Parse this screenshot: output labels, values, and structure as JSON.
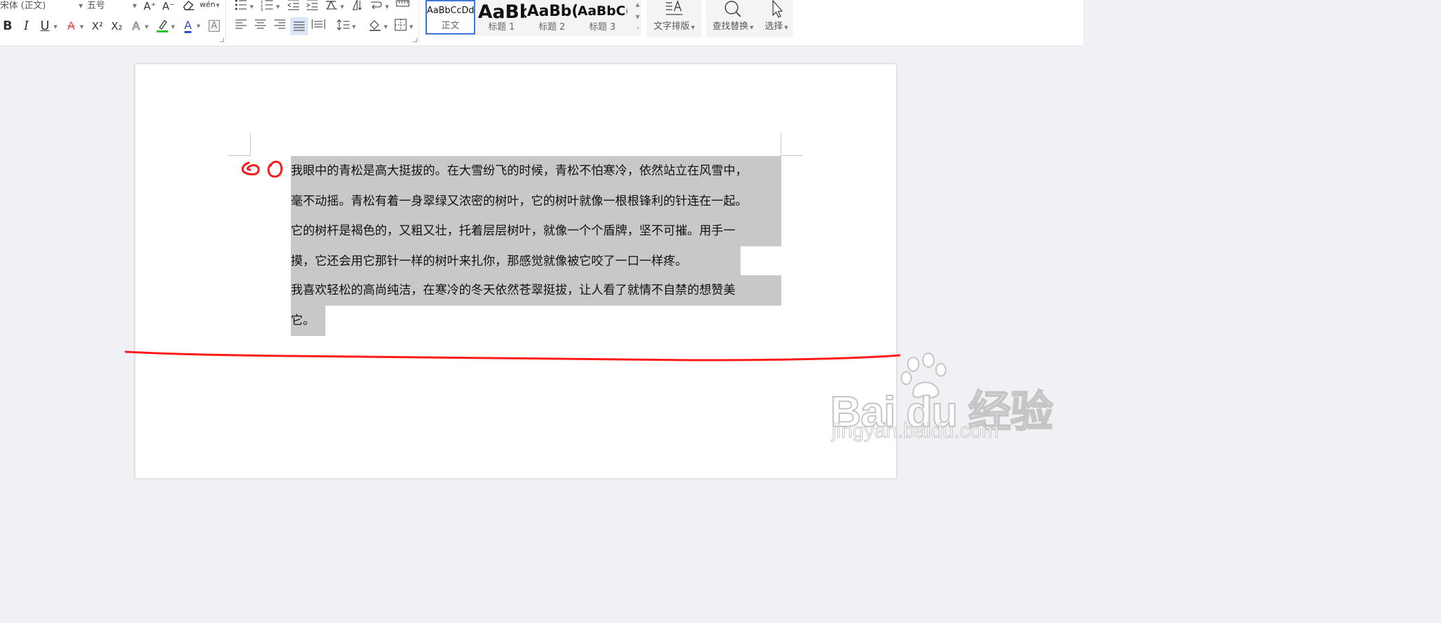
{
  "font": {
    "family_value": "宋体 (正文)",
    "size_value": "五号"
  },
  "font_row1": {
    "grow_label": "A⁺",
    "shrink_label": "A⁻",
    "pinyin_label": "wén"
  },
  "font_row2": {
    "bold_label": "B",
    "italic_label": "I",
    "underline_label": "U",
    "strikethrough_label": "A",
    "superscript_label": "X²",
    "subscript_label": "X₂",
    "text_effect_label": "A",
    "font_color_label": "A",
    "char_border_label": "A"
  },
  "styles": [
    {
      "sample": "AaBbCcDd",
      "name": "正文"
    },
    {
      "sample": "AaBb",
      "name": "标题 1"
    },
    {
      "sample": "AaBb(",
      "name": "标题 2"
    },
    {
      "sample": "AaBbC(",
      "name": "标题 3"
    }
  ],
  "buttons": {
    "text_layout_label": "文字排版",
    "find_replace_label": "查找替换",
    "select_label": "选择"
  },
  "document": {
    "lines": [
      "我眼中的青松是高大挺拔的。在大雪纷飞的时候，青松不怕寒冷，依然站立在风雪中，",
      "毫不动摇。青松有着一身翠绿又浓密的树叶，它的树叶就像一根根锋利的针连在一起。",
      "它的树杆是褐色的，又粗又壮，托着层层树叶，就像一个个盾牌，坚不可摧。用手一",
      "摸，它还会用它那针一样的树叶来扎你，那感觉就像被它咬了一口一样疼。",
      "我喜欢轻松的高尚纯洁，在寒冷的冬天依然苍翠挺拔，让人看了就情不自禁的想赞美",
      "它。"
    ]
  },
  "watermark": {
    "main": "Bai du 经验",
    "sub": "jingyan.baidu.com"
  },
  "colors": {
    "selection": "#c8c8c8",
    "annotation": "#ff1a1a",
    "accent": "#3c78d8"
  }
}
